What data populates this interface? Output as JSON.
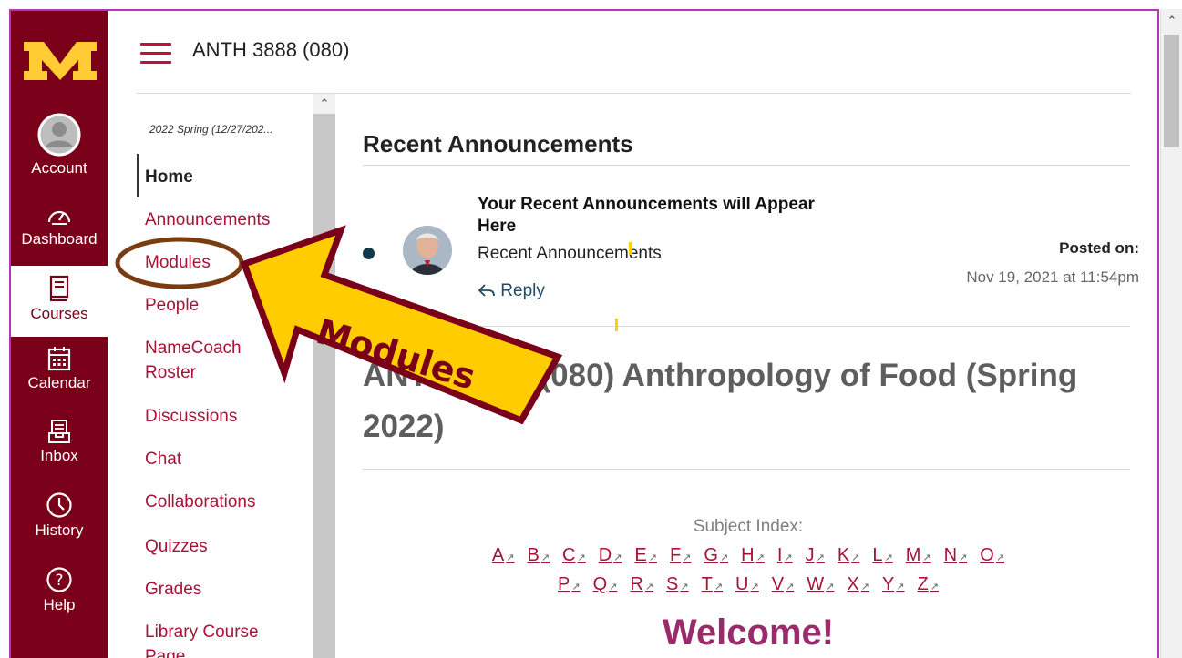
{
  "header": {
    "course_title": "ANTH 3888 (080)"
  },
  "global_nav": {
    "items": [
      {
        "label": "Account",
        "icon": "account-avatar-icon"
      },
      {
        "label": "Dashboard",
        "icon": "dashboard-gauge-icon"
      },
      {
        "label": "Courses",
        "icon": "courses-book-icon",
        "active": true
      },
      {
        "label": "Calendar",
        "icon": "calendar-icon"
      },
      {
        "label": "Inbox",
        "icon": "inbox-tray-icon"
      },
      {
        "label": "History",
        "icon": "history-clock-icon"
      },
      {
        "label": "Help",
        "icon": "help-question-icon"
      }
    ]
  },
  "course_nav": {
    "term": "2022 Spring (12/27/202...",
    "items": [
      {
        "label": "Home",
        "active": true
      },
      {
        "label": "Announcements"
      },
      {
        "label": "Modules"
      },
      {
        "label": "People"
      },
      {
        "label": "NameCoach\nRoster"
      },
      {
        "label": "Discussions"
      },
      {
        "label": "Chat"
      },
      {
        "label": "Collaborations"
      },
      {
        "label": "Quizzes"
      },
      {
        "label": "Grades"
      },
      {
        "label": "Library Course\nPage"
      }
    ]
  },
  "announcements": {
    "heading": "Recent Announcements",
    "title": "Your Recent Announcements will Appear Here",
    "subtitle": "Recent Announcements",
    "reply_label": "Reply",
    "posted_label": "Posted on:",
    "posted_date": "Nov 19, 2021 at 11:54pm"
  },
  "page": {
    "title": "ANTH 3888 (080) Anthropology of Food (Spring 2022)",
    "subject_index_label": "Subject Index:",
    "letters_row1": [
      "A",
      "B",
      "C",
      "D",
      "E",
      "F",
      "G",
      "H",
      "I",
      "J",
      "K",
      "L",
      "M",
      "N",
      "O"
    ],
    "letters_row2": [
      "P",
      "Q",
      "R",
      "S",
      "T",
      "U",
      "V",
      "W",
      "X",
      "Y",
      "Z"
    ],
    "welcome": "Welcome!"
  },
  "annotation": {
    "arrow_label": "Modules"
  },
  "colors": {
    "brand_maroon": "#7a0019",
    "brand_gold": "#ffcc33",
    "link": "#a81437",
    "frame": "#b03aa8",
    "annotation_circle": "#7a3b10"
  }
}
